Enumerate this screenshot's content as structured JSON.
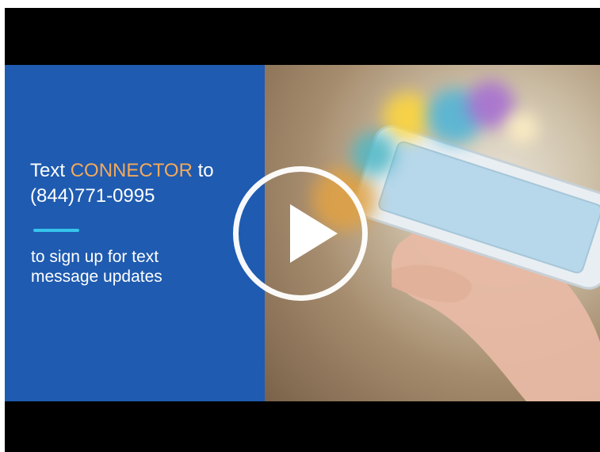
{
  "video": {
    "headline_prefix": "Text ",
    "keyword": "CONNECTOR",
    "headline_suffix": " to",
    "phone_number": "(844)771-0995",
    "subline_1": "to sign up for text",
    "subline_2": "message updates"
  },
  "colors": {
    "panel_blue": "#1f5bb0",
    "keyword_orange": "#f4a95b",
    "divider_cyan": "#35c4ec"
  },
  "icons": {
    "play": "play-icon"
  }
}
